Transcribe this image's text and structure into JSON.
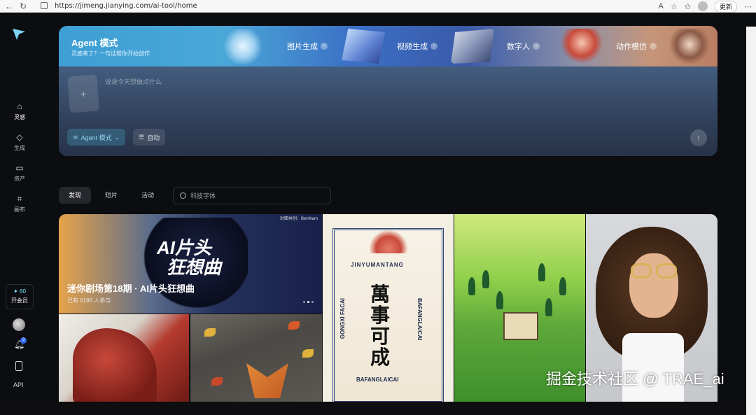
{
  "browser": {
    "url": "https://jimeng.jianying.com/ai-tool/home",
    "update_label": "更新"
  },
  "sidebar": {
    "items": [
      {
        "label": "灵感",
        "icon": "home-icon"
      },
      {
        "label": "生成",
        "icon": "diamond-icon"
      },
      {
        "label": "资产",
        "icon": "folder-icon"
      },
      {
        "label": "画布",
        "icon": "canvas-icon"
      }
    ],
    "credits": "60",
    "vip_label": "开会员",
    "notification_count": "3",
    "api_label": "API"
  },
  "agent": {
    "title": "Agent 模式",
    "subtitle": "灵感来了？一句话帮你开始创作",
    "features": [
      {
        "label": "图片生成"
      },
      {
        "label": "视频生成"
      },
      {
        "label": "数字人"
      },
      {
        "label": "动作模仿"
      }
    ],
    "prompt_placeholder": "说说今天想做点什么",
    "mode_label": "Agent 模式",
    "auto_label": "自动"
  },
  "tabs": [
    {
      "label": "发现",
      "active": true
    },
    {
      "label": "短片",
      "active": false
    },
    {
      "label": "活动",
      "active": false
    }
  ],
  "search": {
    "placeholder": "科技字体"
  },
  "gallery": {
    "hero": {
      "tag": "封面共创：Bentham",
      "logo_line1": "AI片头",
      "logo_line2": "狂想曲",
      "title": "迷你剧场第18期 · AI片头狂想曲",
      "subtitle": "已有 6186 人参与"
    },
    "poster": {
      "top": "JINYUMANTANG",
      "left": "GONGXI FACAI",
      "right": "BAFANGLAICAI",
      "bottom": "BAFANGLAICAI",
      "main": "萬事可成"
    }
  },
  "watermark": "掘金技术社区 @ TRAE_ai"
}
